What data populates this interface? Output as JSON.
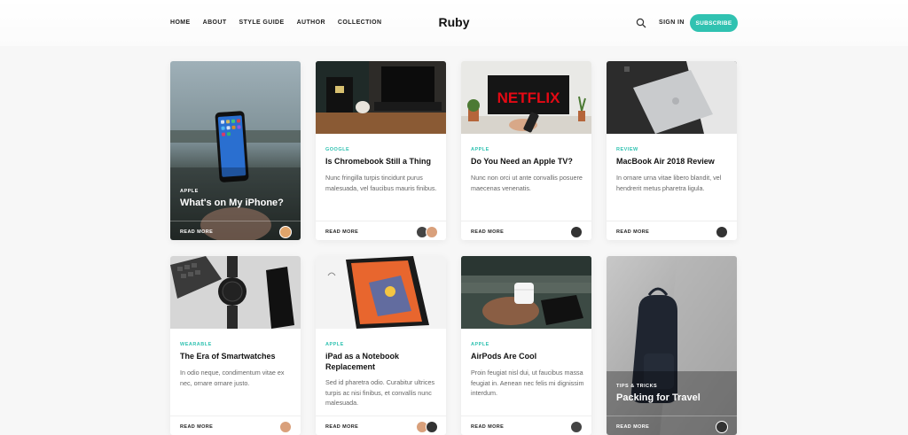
{
  "header": {
    "nav": [
      "HOME",
      "ABOUT",
      "STYLE GUIDE",
      "AUTHOR",
      "COLLECTION"
    ],
    "logo": "Ruby",
    "signin": "SIGN IN",
    "subscribe": "SUBSCRIBE",
    "accent_color": "#30c2b1"
  },
  "cards": [
    {
      "category": "APPLE",
      "title": "What's on My iPhone?",
      "excerpt": "",
      "read_more": "READ MORE",
      "style": "overlay",
      "image": "phone-lake"
    },
    {
      "category": "GOOGLE",
      "title": "Is Chromebook Still a Thing",
      "excerpt": "Nunc fringilla turpis tincidunt purus malesuada, vel faucibus mauris finibus.",
      "read_more": "READ MORE",
      "image": "desk-chromebook"
    },
    {
      "category": "APPLE",
      "title": "Do You Need an Apple TV?",
      "excerpt": "Nunc non orci ut ante convallis posuere maecenas venenatis.",
      "read_more": "READ MORE",
      "image": "netflix-tv",
      "image_text": "NETFLIX"
    },
    {
      "category": "REVIEW",
      "title": "MacBook Air 2018 Review",
      "excerpt": "In ornare urna vitae libero blandit, vel hendrerit metus pharetra ligula.",
      "read_more": "READ MORE",
      "image": "macbook"
    },
    {
      "category": "WEARABLE",
      "title": "The Era of Smartwatches",
      "excerpt": "In odio neque, condimentum vitae ex nec, ornare ornare justo.",
      "read_more": "READ MORE",
      "image": "smartwatch"
    },
    {
      "category": "APPLE",
      "title": "iPad as a Notebook Replacement",
      "excerpt": "Sed id pharetra odio. Curabitur ultrices turpis ac nisi finibus, et convallis nunc malesuada.",
      "read_more": "READ MORE",
      "image": "ipad"
    },
    {
      "category": "APPLE",
      "title": "AirPods Are Cool",
      "excerpt": "Proin feugiat nisl dui, ut faucibus massa feugiat in. Aenean nec felis mi dignissim interdum.",
      "read_more": "READ MORE",
      "image": "airpods"
    },
    {
      "category": "TIPS & TRICKS",
      "title": "Packing for Travel",
      "excerpt": "",
      "read_more": "READ MORE",
      "style": "overlay",
      "image": "backpack"
    }
  ]
}
